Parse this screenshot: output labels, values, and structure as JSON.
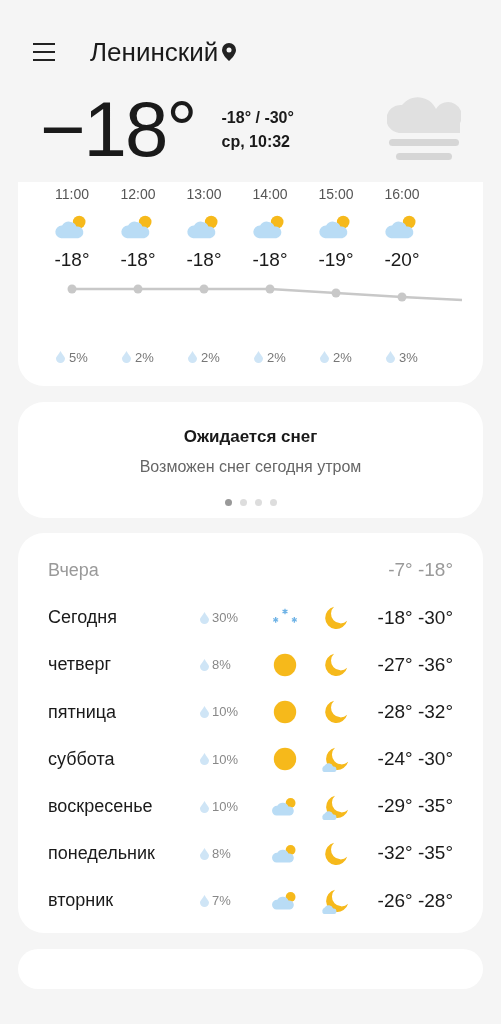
{
  "header": {
    "location": "Ленинский"
  },
  "current": {
    "temp": "−18°",
    "range": "-18° / -30°",
    "datetime": "ср, 10:32",
    "icon": {
      "kind": "fog"
    }
  },
  "hourly": [
    {
      "time": "11:00",
      "kind": "partly_cloudy",
      "temp": "-18°",
      "precip": "5%"
    },
    {
      "time": "12:00",
      "kind": "partly_cloudy",
      "temp": "-18°",
      "precip": "2%"
    },
    {
      "time": "13:00",
      "kind": "partly_cloudy",
      "temp": "-18°",
      "precip": "2%"
    },
    {
      "time": "14:00",
      "kind": "partly_cloudy",
      "temp": "-18°",
      "precip": "2%"
    },
    {
      "time": "15:00",
      "kind": "partly_cloudy",
      "temp": "-19°",
      "precip": "2%"
    },
    {
      "time": "16:00",
      "kind": "partly_cloudy",
      "temp": "-20°",
      "precip": "3%"
    }
  ],
  "alert": {
    "title": "Ожидается снег",
    "text": "Возможен снег сегодня утром",
    "pages": [
      {
        "selected": true
      },
      {
        "selected": false
      },
      {
        "selected": false
      },
      {
        "selected": false
      }
    ]
  },
  "yesterday": {
    "label": "Вчера",
    "temps": "-7° -18°"
  },
  "daily": [
    {
      "day": "Сегодня",
      "precip": "30%",
      "day_icon": {
        "kind": "snow"
      },
      "night_icon": {
        "kind": "moon"
      },
      "temps": "-18° -30°"
    },
    {
      "day": "четверг",
      "precip": "8%",
      "day_icon": {
        "kind": "sun"
      },
      "night_icon": {
        "kind": "moon"
      },
      "temps": "-27° -36°"
    },
    {
      "day": "пятница",
      "precip": "10%",
      "day_icon": {
        "kind": "sun"
      },
      "night_icon": {
        "kind": "moon"
      },
      "temps": "-28° -32°"
    },
    {
      "day": "суббота",
      "precip": "10%",
      "day_icon": {
        "kind": "sun"
      },
      "night_icon": {
        "kind": "moon_cloud"
      },
      "temps": "-24° -30°"
    },
    {
      "day": "воскресенье",
      "precip": "10%",
      "day_icon": {
        "kind": "partly_cloudy"
      },
      "night_icon": {
        "kind": "moon_cloud"
      },
      "temps": "-29° -35°"
    },
    {
      "day": "понедельник",
      "precip": "8%",
      "day_icon": {
        "kind": "partly_cloudy"
      },
      "night_icon": {
        "kind": "moon"
      },
      "temps": "-32° -35°"
    },
    {
      "day": "вторник",
      "precip": "7%",
      "day_icon": {
        "kind": "partly_cloudy"
      },
      "night_icon": {
        "kind": "moon_cloud"
      },
      "temps": "-26° -28°"
    }
  ]
}
